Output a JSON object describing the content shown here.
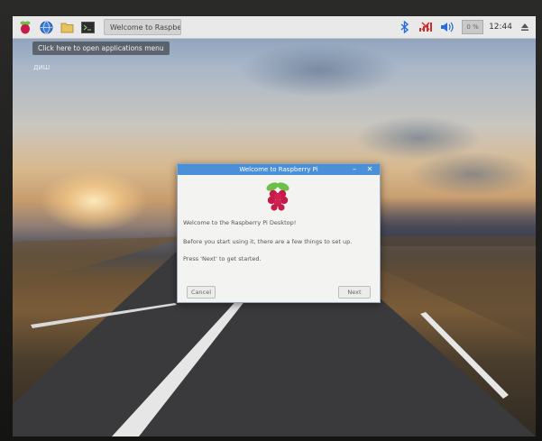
{
  "panel": {
    "menu_tooltip": "Click here to open applications menu",
    "taskbar_item_label": "Welcome to Raspberr...",
    "clock": "12:44",
    "cpu_label": "0 %"
  },
  "desktop": {
    "icon_label": "ДИШ"
  },
  "dialog": {
    "title": "Welcome to Raspberry Pi",
    "line1": "Welcome to the Raspberry Pi Desktop!",
    "line2": "Before you start using it, there are a few things to set up.",
    "line3": "Press 'Next' to get started.",
    "cancel_label": "Cancel",
    "next_label": "Next",
    "minimize_glyph": "–",
    "close_glyph": "✕"
  },
  "colors": {
    "titlebar": "#4a90d9",
    "panel": "#e9e9e9",
    "raspberry": "#c51a4a",
    "leaf": "#6cc04a",
    "bluetooth": "#2b6fd6",
    "network_error": "#d62b2b"
  },
  "icons": [
    "raspberry-menu-icon",
    "web-browser-icon",
    "file-manager-icon",
    "terminal-icon",
    "bluetooth-icon",
    "network-disconnected-icon",
    "volume-icon",
    "eject-icon"
  ]
}
